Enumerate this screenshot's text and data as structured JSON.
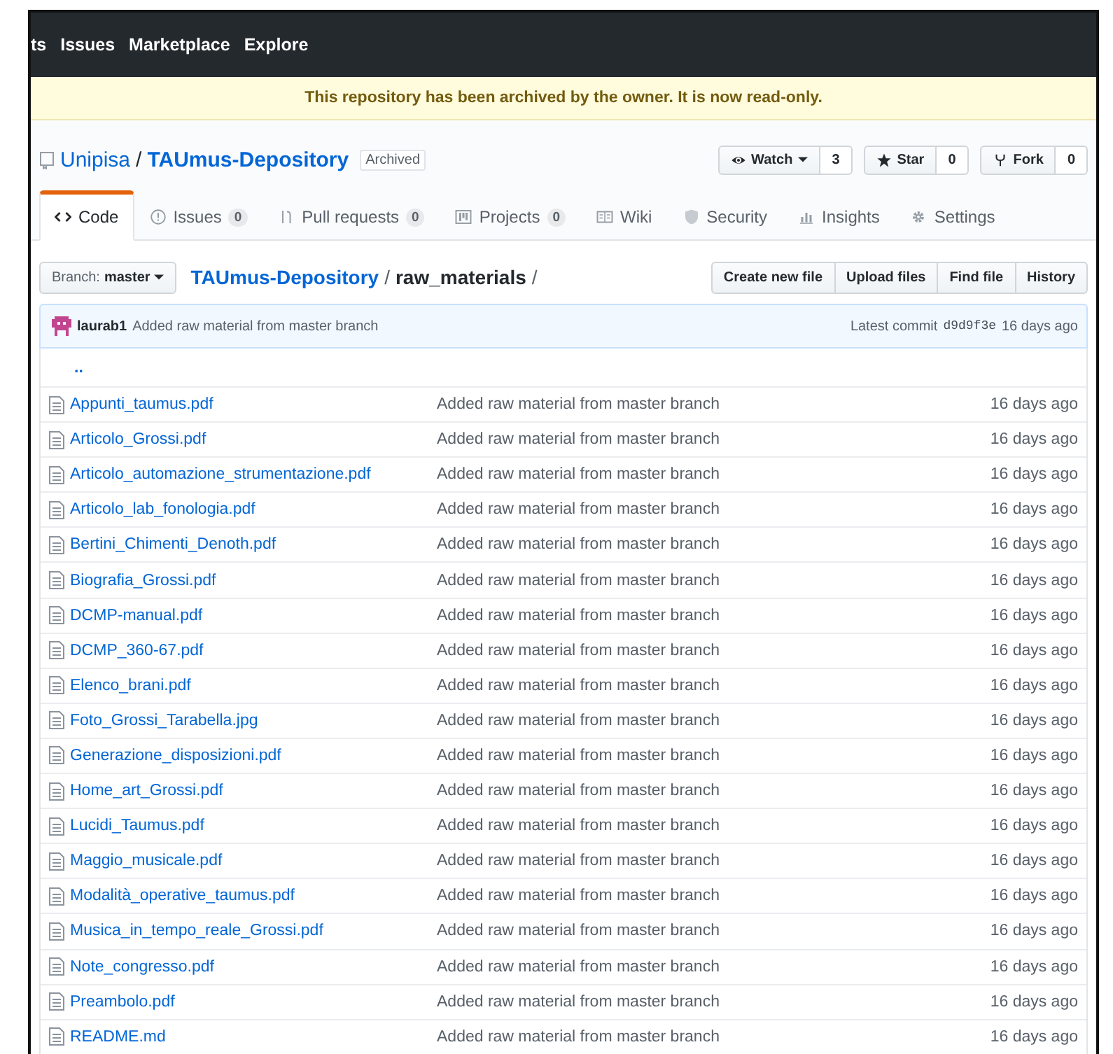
{
  "top_nav": {
    "items": [
      "ts",
      "Issues",
      "Marketplace",
      "Explore"
    ]
  },
  "archive_banner": "This repository has been archived by the owner. It is now read-only.",
  "repo": {
    "owner": "Unipisa",
    "separator": "/",
    "name": "TAUmus-Depository",
    "label": "Archived",
    "actions": [
      {
        "label": "Watch",
        "caret": true,
        "count": "3"
      },
      {
        "label": "Star",
        "caret": false,
        "count": "0"
      },
      {
        "label": "Fork",
        "caret": false,
        "count": "0"
      }
    ]
  },
  "tabs": [
    {
      "label": "Code",
      "selected": true
    },
    {
      "label": "Issues",
      "counter": "0",
      "selected": false
    },
    {
      "label": "Pull requests",
      "counter": "0",
      "selected": false
    },
    {
      "label": "Projects",
      "counter": "0",
      "selected": false
    },
    {
      "label": "Wiki",
      "selected": false
    },
    {
      "label": "Security",
      "selected": false
    },
    {
      "label": "Insights",
      "selected": false
    },
    {
      "label": "Settings",
      "selected": false
    }
  ],
  "branch": {
    "prefix": "Branch:",
    "name": "master"
  },
  "breadcrumb": {
    "repo": "TAUmus-Depository",
    "separator": "/",
    "folder": "raw_materials",
    "trailing": "/"
  },
  "file_buttons": [
    "Create new file",
    "Upload files",
    "Find file",
    "History"
  ],
  "latest_commit": {
    "author": "laurab1",
    "message": "Added raw material from master branch",
    "prefix": "Latest commit",
    "sha": "d9d9f3e",
    "age": "16 days ago"
  },
  "parent_link": "..",
  "files": [
    {
      "name": "Appunti_taumus.pdf",
      "message": "Added raw material from master branch",
      "age": "16 days ago"
    },
    {
      "name": "Articolo_Grossi.pdf",
      "message": "Added raw material from master branch",
      "age": "16 days ago"
    },
    {
      "name": "Articolo_automazione_strumentazione.pdf",
      "message": "Added raw material from master branch",
      "age": "16 days ago"
    },
    {
      "name": "Articolo_lab_fonologia.pdf",
      "message": "Added raw material from master branch",
      "age": "16 days ago"
    },
    {
      "name": "Bertini_Chimenti_Denoth.pdf",
      "message": "Added raw material from master branch",
      "age": "16 days ago"
    },
    {
      "name": "Biografia_Grossi.pdf",
      "message": "Added raw material from master branch",
      "age": "16 days ago"
    },
    {
      "name": "DCMP-manual.pdf",
      "message": "Added raw material from master branch",
      "age": "16 days ago"
    },
    {
      "name": "DCMP_360-67.pdf",
      "message": "Added raw material from master branch",
      "age": "16 days ago"
    },
    {
      "name": "Elenco_brani.pdf",
      "message": "Added raw material from master branch",
      "age": "16 days ago"
    },
    {
      "name": "Foto_Grossi_Tarabella.jpg",
      "message": "Added raw material from master branch",
      "age": "16 days ago"
    },
    {
      "name": "Generazione_disposizioni.pdf",
      "message": "Added raw material from master branch",
      "age": "16 days ago"
    },
    {
      "name": "Home_art_Grossi.pdf",
      "message": "Added raw material from master branch",
      "age": "16 days ago"
    },
    {
      "name": "Lucidi_Taumus.pdf",
      "message": "Added raw material from master branch",
      "age": "16 days ago"
    },
    {
      "name": "Maggio_musicale.pdf",
      "message": "Added raw material from master branch",
      "age": "16 days ago"
    },
    {
      "name": "Modalità_operative_taumus.pdf",
      "message": "Added raw material from master branch",
      "age": "16 days ago"
    },
    {
      "name": "Musica_in_tempo_reale_Grossi.pdf",
      "message": "Added raw material from master branch",
      "age": "16 days ago"
    },
    {
      "name": "Note_congresso.pdf",
      "message": "Added raw material from master branch",
      "age": "16 days ago"
    },
    {
      "name": "Preambolo.pdf",
      "message": "Added raw material from master branch",
      "age": "16 days ago"
    },
    {
      "name": "README.md",
      "message": "Added raw material from master branch",
      "age": "16 days ago"
    }
  ]
}
